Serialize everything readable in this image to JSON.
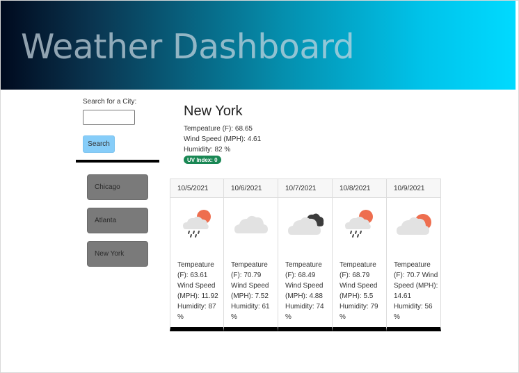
{
  "header": {
    "title": "Weather Dashboard"
  },
  "search": {
    "label": "Search for a City:",
    "input_value": "",
    "button_label": "Search"
  },
  "history": [
    "Chicago",
    "Atlanta",
    "New York"
  ],
  "current": {
    "city": "New York",
    "temp": "Tempeature (F): 68.65",
    "wind": "Wind Speed (MPH): 4.61",
    "humidity": "Humidity: 82 %",
    "uv": "UV Index: 0",
    "uv_color": "#198754"
  },
  "forecast": [
    {
      "date": "10/5/2021",
      "icon": "rain-sun-icon",
      "text": "Tempeature (F): 63.61 Wind Speed (MPH): 11.92 Humidity: 87 %"
    },
    {
      "date": "10/6/2021",
      "icon": "cloud-icon",
      "text": "Tempeature (F): 70.79 Wind Speed (MPH): 7.52 Humidity: 61 %"
    },
    {
      "date": "10/7/2021",
      "icon": "broken-clouds-icon",
      "text": "Tempeature (F): 68.49 Wind Speed (MPH): 4.88 Humidity: 74 %"
    },
    {
      "date": "10/8/2021",
      "icon": "rain-sun-icon",
      "text": "Tempeature (F): 68.79 Wind Speed (MPH): 5.5 Humidity: 79 %"
    },
    {
      "date": "10/9/2021",
      "icon": "partly-cloudy-icon",
      "text": "Tempeature (F): 70.7 Wind Speed (MPH): 14.61 Humidity: 56 %"
    }
  ],
  "colors": {
    "header_start": "#000a1e",
    "header_end": "#00daff",
    "search_button": "#86cdf9",
    "history_button": "#7a7a7a"
  }
}
